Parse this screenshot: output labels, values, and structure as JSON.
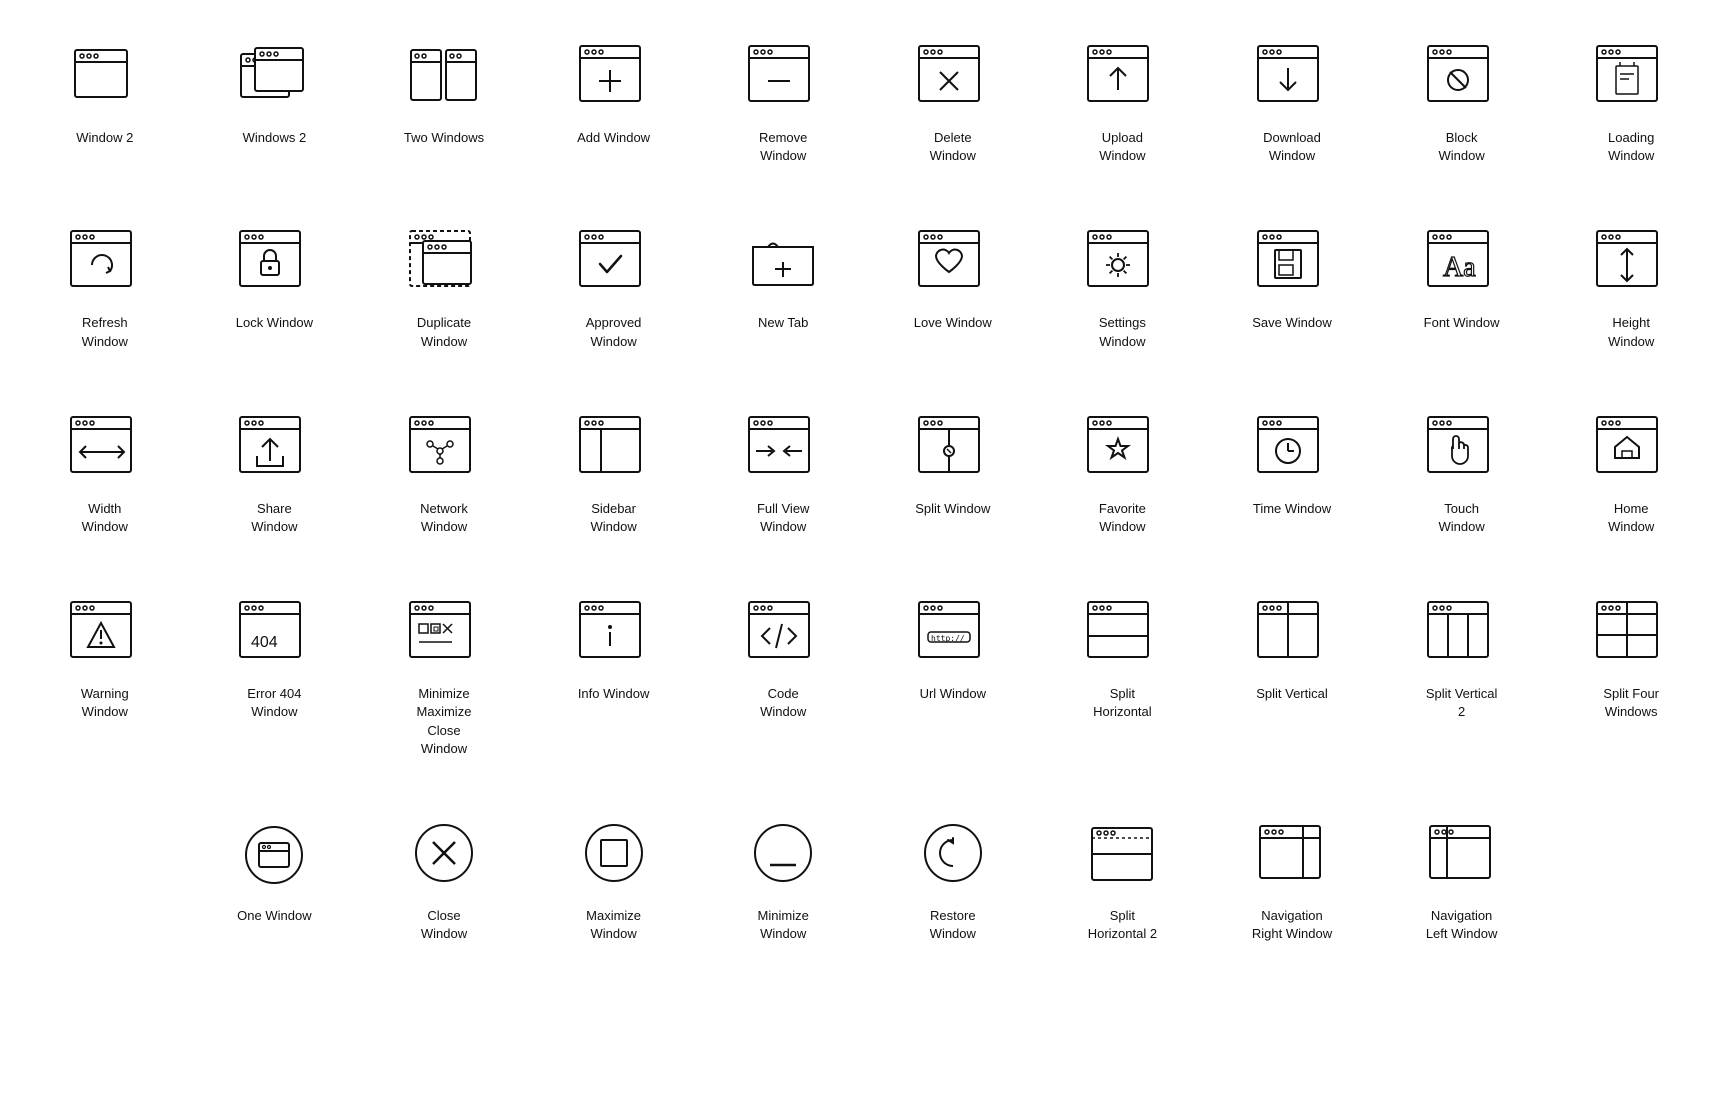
{
  "icons": [
    {
      "id": "window-2",
      "label": "Window 2",
      "row": 1
    },
    {
      "id": "windows-2",
      "label": "Windows 2",
      "row": 1
    },
    {
      "id": "two-windows",
      "label": "Two Windows",
      "row": 1
    },
    {
      "id": "add-window",
      "label": "Add Window",
      "row": 1
    },
    {
      "id": "remove-window",
      "label": "Remove\nWindow",
      "row": 1
    },
    {
      "id": "delete-window",
      "label": "Delete\nWindow",
      "row": 1
    },
    {
      "id": "upload-window",
      "label": "Upload\nWindow",
      "row": 1
    },
    {
      "id": "download-window",
      "label": "Download\nWindow",
      "row": 1
    },
    {
      "id": "block-window",
      "label": "Block\nWindow",
      "row": 1
    },
    {
      "id": "loading-window",
      "label": "Loading\nWindow",
      "row": 1
    },
    {
      "id": "refresh-window",
      "label": "Refresh\nWindow",
      "row": 2
    },
    {
      "id": "lock-window",
      "label": "Lock Window",
      "row": 2
    },
    {
      "id": "duplicate-window",
      "label": "Duplicate\nWindow",
      "row": 2
    },
    {
      "id": "approved-window",
      "label": "Approved\nWindow",
      "row": 2
    },
    {
      "id": "new-tab",
      "label": "New Tab",
      "row": 2
    },
    {
      "id": "love-window",
      "label": "Love Window",
      "row": 2
    },
    {
      "id": "settings-window",
      "label": "Settings\nWindow",
      "row": 2
    },
    {
      "id": "save-window",
      "label": "Save Window",
      "row": 2
    },
    {
      "id": "font-window",
      "label": "Font Window",
      "row": 2
    },
    {
      "id": "height-window",
      "label": "Height\nWindow",
      "row": 2
    },
    {
      "id": "width-window",
      "label": "Width\nWindow",
      "row": 3
    },
    {
      "id": "share-window",
      "label": "Share\nWindow",
      "row": 3
    },
    {
      "id": "network-window",
      "label": "Network\nWindow",
      "row": 3
    },
    {
      "id": "sidebar-window",
      "label": "Sidebar\nWindow",
      "row": 3
    },
    {
      "id": "full-view-window",
      "label": "Full View\nWindow",
      "row": 3
    },
    {
      "id": "split-window",
      "label": "Split Window",
      "row": 3
    },
    {
      "id": "favorite-window",
      "label": "Favorite\nWindow",
      "row": 3
    },
    {
      "id": "time-window",
      "label": "Time Window",
      "row": 3
    },
    {
      "id": "touch-window",
      "label": "Touch\nWindow",
      "row": 3
    },
    {
      "id": "home-window",
      "label": "Home\nWindow",
      "row": 3
    },
    {
      "id": "warning-window",
      "label": "Warning\nWindow",
      "row": 4
    },
    {
      "id": "error-404-window",
      "label": "Error 404\nWindow",
      "row": 4
    },
    {
      "id": "minimize-maximize-close-window",
      "label": "Minimize\nMaximize\nClose\nWindow",
      "row": 4
    },
    {
      "id": "info-window",
      "label": "Info Window",
      "row": 4
    },
    {
      "id": "code-window",
      "label": "Code\nWindow",
      "row": 4
    },
    {
      "id": "url-window",
      "label": "Url Window",
      "row": 4
    },
    {
      "id": "split-horizontal",
      "label": "Split\nHorizontal",
      "row": 4
    },
    {
      "id": "split-vertical",
      "label": "Split Vertical",
      "row": 4
    },
    {
      "id": "split-vertical-2",
      "label": "Split Vertical\n2",
      "row": 4
    },
    {
      "id": "split-four-windows",
      "label": "Split Four\nWindows",
      "row": 4
    },
    {
      "id": "spacer5a",
      "label": "",
      "row": 5
    },
    {
      "id": "one-window",
      "label": "One Window",
      "row": 5
    },
    {
      "id": "close-window",
      "label": "Close\nWindow",
      "row": 5
    },
    {
      "id": "maximize-window",
      "label": "Maximize\nWindow",
      "row": 5
    },
    {
      "id": "minimize-window",
      "label": "Minimize\nWindow",
      "row": 5
    },
    {
      "id": "restore-window",
      "label": "Restore\nWindow",
      "row": 5
    },
    {
      "id": "split-horizontal-2",
      "label": "Split\nHorizontal 2",
      "row": 5
    },
    {
      "id": "navigation-right-window",
      "label": "Navigation\nRight Window",
      "row": 5
    },
    {
      "id": "navigation-left-window",
      "label": "Navigation\nLeft Window",
      "row": 5
    },
    {
      "id": "spacer5b",
      "label": "",
      "row": 5
    }
  ]
}
